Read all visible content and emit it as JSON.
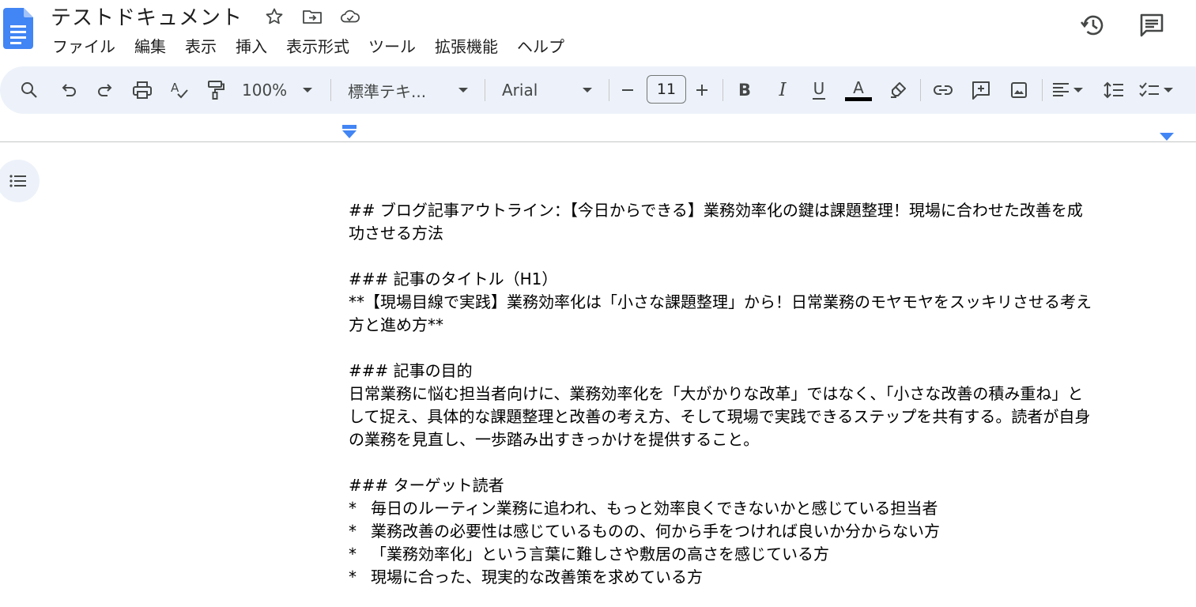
{
  "document": {
    "title": "テストドキュメント"
  },
  "menu": {
    "items": [
      "ファイル",
      "編集",
      "表示",
      "挿入",
      "表示形式",
      "ツール",
      "拡張機能",
      "ヘルプ"
    ]
  },
  "toolbar": {
    "zoom": "100%",
    "style": "標準テキ...",
    "font": "Arial",
    "font_size": "11"
  },
  "icons": {
    "search": "search-icon",
    "undo": "undo-icon",
    "redo": "redo-icon",
    "print": "print-icon",
    "spellcheck": "spellcheck-icon",
    "paint_format": "paint-format-icon",
    "bold": "B",
    "italic": "I",
    "underline": "U",
    "text_color": "A",
    "highlight": "highlighter-icon",
    "link": "link-icon",
    "comment": "add-comment-icon",
    "image": "image-icon",
    "align": "align-left-icon",
    "line_spacing": "line-spacing-icon",
    "checklist": "checklist-icon",
    "history": "history-icon",
    "comments": "comments-icon",
    "outline": "outline-icon"
  },
  "colors": {
    "docs_blue": "#4285f4",
    "toolbar_bg": "#edf2fa",
    "text_color_bar": "#000000"
  },
  "content": {
    "heading_line1": "## ブログ記事アウトライン：【今日からできる】業務効率化の鍵は課題整理！現場に合わせた改善を成",
    "heading_line2": "功させる方法",
    "title_section_heading": "### 記事のタイトル（H1）",
    "title_line1": "**【現場目線で実践】業務効率化は「小さな課題整理」から！日常業務のモヤモヤをスッキリさせる考え",
    "title_line2": "方と進め方**",
    "purpose_heading": "### 記事の目的",
    "purpose_line1": "日常業務に悩む担当者向けに、業務効率化を「大がかりな改革」ではなく、「小さな改善の積み重ね」と",
    "purpose_line2": "して捉え、具体的な課題整理と改善の考え方、そして現場で実践できるステップを共有する。読者が自身",
    "purpose_line3": "の業務を見直し、一歩踏み出すきっかけを提供すること。",
    "target_heading": "### ターゲット読者",
    "bullet_marker": "*",
    "target_items": [
      "毎日のルーティン業務に追われ、もっと効率良くできないかと感じている担当者",
      "業務改善の必要性は感じているものの、何から手をつければ良いか分からない方",
      "「業務効率化」という言葉に難しさや敷居の高さを感じている方",
      "現場に合った、現実的な改善策を求めている方"
    ]
  }
}
